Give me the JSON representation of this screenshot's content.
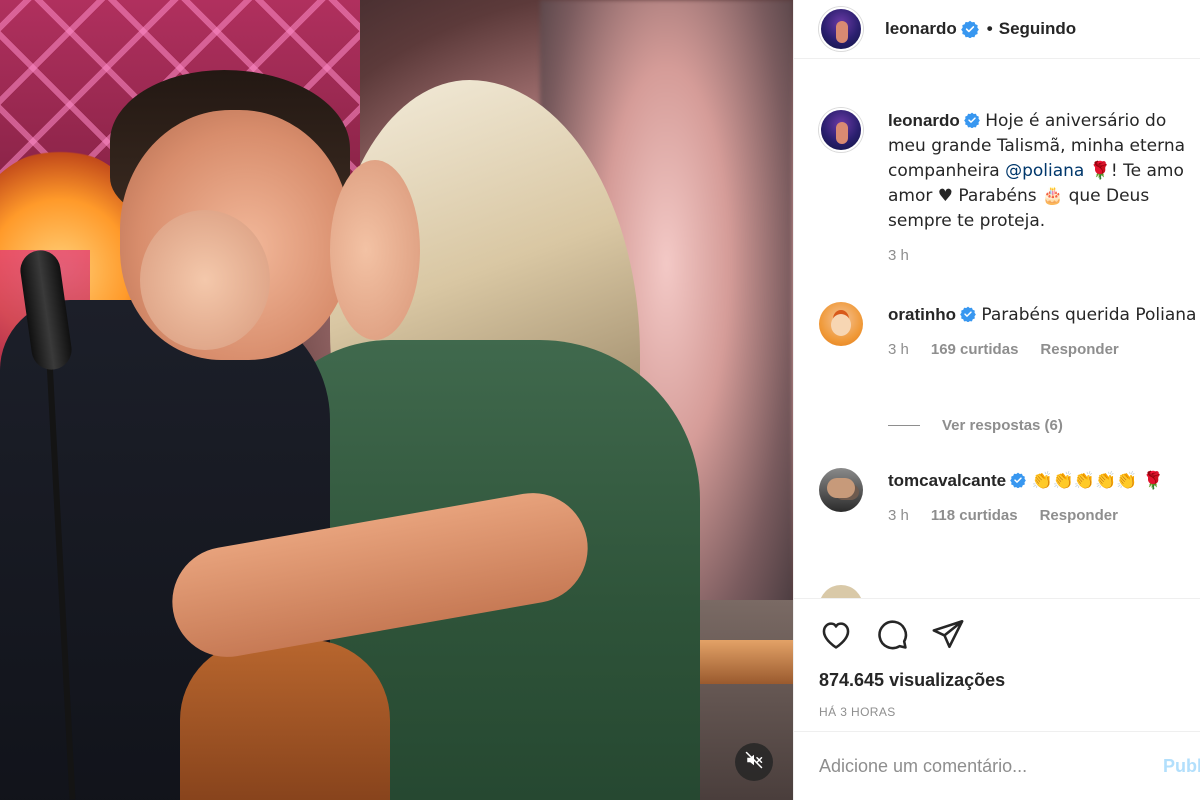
{
  "header": {
    "username": "leonardo",
    "separator": "•",
    "follow_status": "Seguindo"
  },
  "caption": {
    "username": "leonardo",
    "text_before": " Hoje é aniversário do meu grande Talismã, minha eterna companheira ",
    "mention": "@poliana",
    "text_after": " 🌹! Te amo amor ♥ Parabéns 🎂 que Deus sempre te proteja.",
    "time": "3 h"
  },
  "comments": [
    {
      "username": "oratinho",
      "text": " Parabéns querida Poliana",
      "time": "3 h",
      "likes": "169 curtidas",
      "reply": "Responder",
      "view_replies": "Ver respostas (6)"
    },
    {
      "username": "tomcavalcante",
      "text": " 👏👏👏👏👏 🌹",
      "time": "3 h",
      "likes": "118 curtidas",
      "reply": "Responder"
    }
  ],
  "actions": {
    "views": "874.645 visualizações",
    "posted": "HÁ 3 HORAS"
  },
  "add_comment": {
    "placeholder": "Adicione um comentário...",
    "publish": "Publ"
  },
  "icons": {
    "like": "heart-icon",
    "comment": "comment-icon",
    "share": "share-icon",
    "mute": "muted-speaker-icon",
    "verified": "verified-badge-icon"
  },
  "colors": {
    "verified": "#3897f0",
    "mention": "#00376b",
    "muted_text": "#8e8e8e",
    "publish_disabled": "#b2dffc"
  }
}
